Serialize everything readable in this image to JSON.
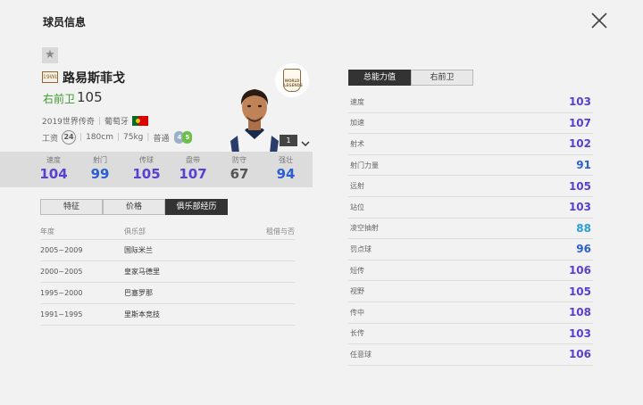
{
  "header": {
    "title": "球员信息"
  },
  "player": {
    "season": "19WL",
    "name": "路易斯菲戈",
    "position": "右前卫",
    "overall": "105",
    "season_name": "2019世界传奇",
    "nationality": "葡萄牙",
    "salary_label": "工资",
    "salary": "24",
    "height": "180cm",
    "weight": "75kg",
    "body_type": "普通",
    "weak_foot_left": "4",
    "weak_foot_right": "5",
    "badge_text": "WORLD LEGENDS",
    "level": "1"
  },
  "stats": [
    {
      "label": "速度",
      "value": "104",
      "color": "#5b3fd1"
    },
    {
      "label": "射门",
      "value": "99",
      "color": "#2b5fd1"
    },
    {
      "label": "传球",
      "value": "105",
      "color": "#5b3fd1"
    },
    {
      "label": "盘带",
      "value": "107",
      "color": "#5b3fd1"
    },
    {
      "label": "防守",
      "value": "67",
      "color": "#555555"
    },
    {
      "label": "强壮",
      "value": "94",
      "color": "#2b5fd1"
    }
  ],
  "tabs": [
    {
      "label": "特征"
    },
    {
      "label": "价格"
    },
    {
      "label": "俱乐部经历"
    }
  ],
  "club_history": {
    "headers": {
      "year": "年度",
      "club": "俱乐部",
      "loan": "租借与否"
    },
    "rows": [
      {
        "year": "2005~2009",
        "club": "国际米兰"
      },
      {
        "year": "2000~2005",
        "club": "皇家马德里"
      },
      {
        "year": "1995~2000",
        "club": "巴塞罗那"
      },
      {
        "year": "1991~1995",
        "club": "里斯本竞技"
      }
    ]
  },
  "right_tabs": [
    {
      "label": "总能力值"
    },
    {
      "label": "右前卫"
    }
  ],
  "attributes": [
    {
      "name": "速度",
      "value": "103",
      "color": "#5b3fd1"
    },
    {
      "name": "加速",
      "value": "107",
      "color": "#5b3fd1"
    },
    {
      "name": "射术",
      "value": "102",
      "color": "#5b3fd1"
    },
    {
      "name": "射门力量",
      "value": "91",
      "color": "#2b5fd1"
    },
    {
      "name": "远射",
      "value": "105",
      "color": "#5b3fd1"
    },
    {
      "name": "站位",
      "value": "103",
      "color": "#5b3fd1"
    },
    {
      "name": "凌空抽射",
      "value": "88",
      "color": "#2a9fd6"
    },
    {
      "name": "罚点球",
      "value": "96",
      "color": "#2b5fd1"
    },
    {
      "name": "短传",
      "value": "106",
      "color": "#5b3fd1"
    },
    {
      "name": "视野",
      "value": "105",
      "color": "#5b3fd1"
    },
    {
      "name": "传中",
      "value": "108",
      "color": "#5b3fd1"
    },
    {
      "name": "长传",
      "value": "103",
      "color": "#5b3fd1"
    },
    {
      "name": "任意球",
      "value": "106",
      "color": "#5b3fd1"
    }
  ]
}
